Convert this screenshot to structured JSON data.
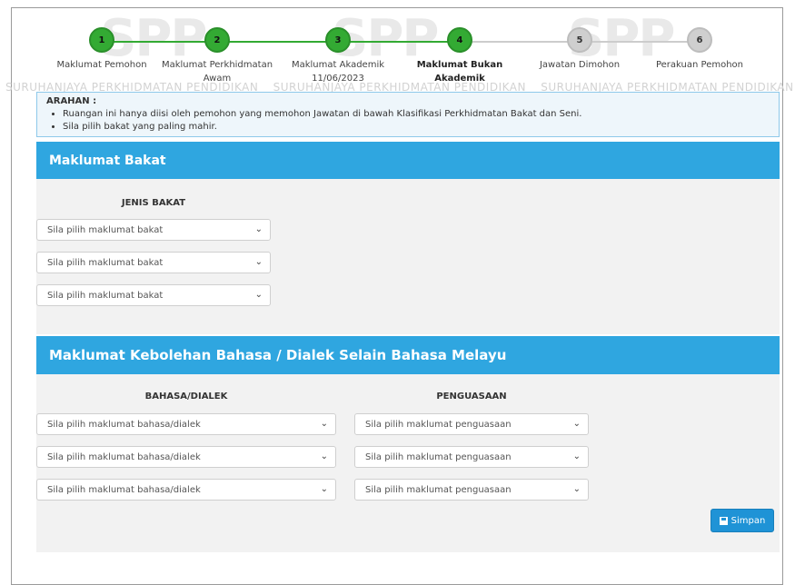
{
  "watermark": {
    "logo_text": "SPP",
    "repeat_text": "SURUHANJAYA PERKHIDMATAN PENDIDIKAN"
  },
  "stepper": {
    "steps": [
      {
        "number": "1",
        "label": "Maklumat Pemohon",
        "sublabel": "",
        "state": "done"
      },
      {
        "number": "2",
        "label": "Maklumat Perkhidmatan",
        "sublabel": "Awam",
        "state": "done"
      },
      {
        "number": "3",
        "label": "Maklumat Akademik",
        "sublabel": "11/06/2023",
        "state": "done"
      },
      {
        "number": "4",
        "label": "Maklumat Bukan",
        "sublabel": "Akademik",
        "state": "active"
      },
      {
        "number": "5",
        "label": "Jawatan Dimohon",
        "sublabel": "",
        "state": "pending"
      },
      {
        "number": "6",
        "label": "Perakuan Pemohon",
        "sublabel": "",
        "state": "pending"
      }
    ]
  },
  "arahan": {
    "title": "ARAHAN :",
    "items": [
      "Ruangan ini hanya diisi oleh pemohon yang memohon Jawatan di bawah Klasifikasi Perkhidmatan Bakat dan Seni.",
      "Sila pilih bakat yang paling mahir."
    ]
  },
  "bakat": {
    "title": "Maklumat Bakat",
    "column": "JENIS BAKAT",
    "selects": [
      "Sila pilih maklumat bakat",
      "Sila pilih maklumat bakat",
      "Sila pilih maklumat bakat"
    ]
  },
  "bahasa": {
    "title": "Maklumat Kebolehan Bahasa / Dialek Selain Bahasa Melayu",
    "column_lang": "BAHASA/DIALEK",
    "column_level": "PENGUASAAN",
    "rows": [
      {
        "lang": "Sila pilih maklumat bahasa/dialek",
        "level": "Sila pilih maklumat penguasaan"
      },
      {
        "lang": "Sila pilih maklumat bahasa/dialek",
        "level": "Sila pilih maklumat penguasaan"
      },
      {
        "lang": "Sila pilih maklumat bahasa/dialek",
        "level": "Sila pilih maklumat penguasaan"
      }
    ]
  },
  "save_button": {
    "label": "Simpan",
    "icon": "save-icon"
  },
  "colors": {
    "primary": "#2fa6e0",
    "done": "#33aa33",
    "pending": "#cfcfcf"
  }
}
